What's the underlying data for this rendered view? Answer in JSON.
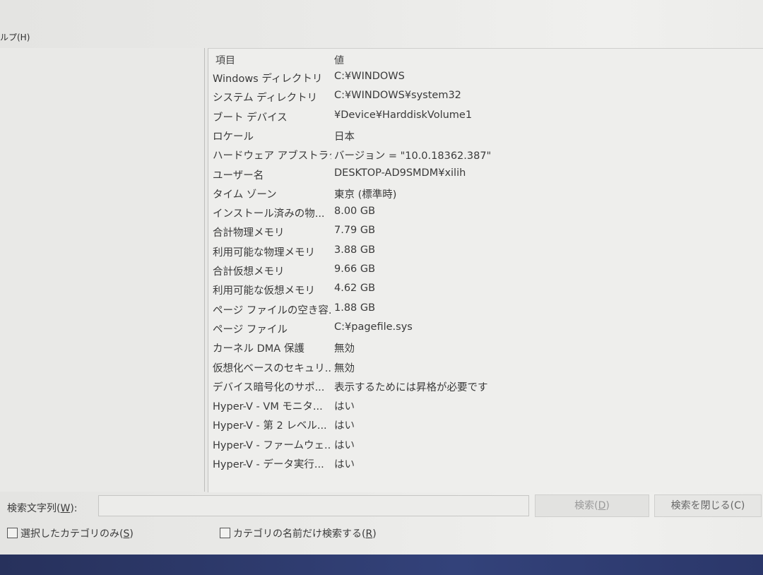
{
  "menu": {
    "help": "ルプ(H)"
  },
  "list": {
    "header": {
      "item": "項目",
      "value": "値"
    },
    "rows": [
      {
        "item": "Windows ディレクトリ",
        "value": "C:¥WINDOWS"
      },
      {
        "item": "システム ディレクトリ",
        "value": "C:¥WINDOWS¥system32"
      },
      {
        "item": "ブート デバイス",
        "value": "¥Device¥HarddiskVolume1"
      },
      {
        "item": "ロケール",
        "value": "日本"
      },
      {
        "item": "ハードウェア アブストラク...",
        "value": "バージョン = \"10.0.18362.387\""
      },
      {
        "item": "ユーザー名",
        "value": "DESKTOP-AD9SMDM¥xilih"
      },
      {
        "item": "タイム ゾーン",
        "value": "東京 (標準時)"
      },
      {
        "item": "インストール済みの物...",
        "value": "8.00 GB"
      },
      {
        "item": "合計物理メモリ",
        "value": "7.79 GB"
      },
      {
        "item": "利用可能な物理メモリ",
        "value": "3.88 GB"
      },
      {
        "item": "合計仮想メモリ",
        "value": "9.66 GB"
      },
      {
        "item": "利用可能な仮想メモリ",
        "value": "4.62 GB"
      },
      {
        "item": "ページ ファイルの空き容...",
        "value": "1.88 GB"
      },
      {
        "item": "ページ ファイル",
        "value": "C:¥pagefile.sys"
      },
      {
        "item": "カーネル DMA 保護",
        "value": "無効"
      },
      {
        "item": "仮想化ベースのセキュリ...",
        "value": "無効"
      },
      {
        "item": "デバイス暗号化のサポ...",
        "value": "表示するためには昇格が必要です"
      },
      {
        "item": "Hyper-V - VM モニタ...",
        "value": "はい"
      },
      {
        "item": "Hyper-V - 第 2 レベル...",
        "value": "はい"
      },
      {
        "item": "Hyper-V - ファームウェ...",
        "value": "はい"
      },
      {
        "item": "Hyper-V - データ実行...",
        "value": "はい"
      }
    ]
  },
  "search": {
    "label_prefix": "検索文字列(",
    "label_key": "W",
    "label_suffix": "):",
    "input_value": "",
    "search_button_prefix": "検索(",
    "search_button_key": "D",
    "search_button_suffix": ")",
    "close_button": "検索を閉じる(C)",
    "selected_category_prefix": "選択したカテゴリのみ(",
    "selected_category_key": "S",
    "selected_category_suffix": ")",
    "selected_category_checked": false,
    "names_only_prefix": "カテゴリの名前だけ検索する(",
    "names_only_key": "R",
    "names_only_suffix": ")",
    "names_only_checked": false
  }
}
